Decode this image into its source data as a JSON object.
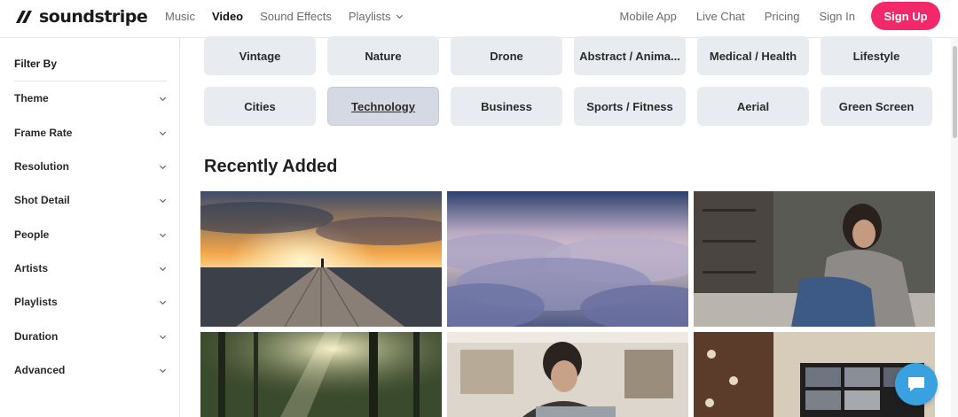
{
  "header": {
    "logo_text": "soundstripe",
    "nav_left": [
      "Music",
      "Video",
      "Sound Effects",
      "Playlists"
    ],
    "active_nav": "Video",
    "nav_right": [
      "Mobile App",
      "Live Chat",
      "Pricing",
      "Sign In"
    ],
    "signup_label": "Sign Up",
    "brand_color": "#f2286a"
  },
  "sidebar": {
    "title": "Filter By",
    "filters": [
      "Theme",
      "Frame Rate",
      "Resolution",
      "Shot Detail",
      "People",
      "Artists",
      "Playlists",
      "Duration",
      "Advanced"
    ]
  },
  "categories": {
    "row1": [
      "Vintage",
      "Nature",
      "Drone",
      "Abstract / Anima...",
      "Medical / Health",
      "Lifestyle"
    ],
    "row2": [
      "Cities",
      "Technology",
      "Business",
      "Sports / Fitness",
      "Aerial",
      "Green Screen"
    ],
    "selected": "Technology"
  },
  "recently_added": {
    "title": "Recently Added",
    "thumbnails": [
      {
        "subject": "pier-sunset"
      },
      {
        "subject": "clouds-aerial"
      },
      {
        "subject": "woman-sitting-couch"
      },
      {
        "subject": "forest-sunbeams"
      },
      {
        "subject": "stressed-woman-desk"
      },
      {
        "subject": "video-call-laptop"
      }
    ]
  },
  "chat": {
    "icon": "chat-bubble-icon",
    "color": "#3aa1e0"
  }
}
